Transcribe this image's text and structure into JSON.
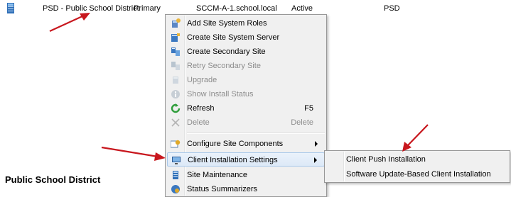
{
  "site_row": {
    "code_name": "PSD - Public School District",
    "type": "Primary",
    "server": "SCCM-A-1.school.local",
    "state": "Active",
    "code": "PSD"
  },
  "details_heading": "Public School District",
  "context_menu": {
    "items": [
      {
        "label": "Add Site System Roles",
        "icon": "add-roles-icon",
        "enabled": true
      },
      {
        "label": "Create Site System Server",
        "icon": "create-server-icon",
        "enabled": true
      },
      {
        "label": "Create Secondary Site",
        "icon": "secondary-site-icon",
        "enabled": true
      },
      {
        "label": "Retry Secondary Site",
        "icon": "retry-icon",
        "enabled": false
      },
      {
        "label": "Upgrade",
        "icon": "upgrade-icon",
        "enabled": false
      },
      {
        "label": "Show Install Status",
        "icon": "info-icon",
        "enabled": false
      },
      {
        "label": "Refresh",
        "icon": "refresh-icon",
        "enabled": true,
        "shortcut": "F5"
      },
      {
        "label": "Delete",
        "icon": "delete-icon",
        "enabled": false,
        "shortcut": "Delete"
      },
      {
        "label": "Configure Site Components",
        "icon": "configure-icon",
        "enabled": true,
        "submenu": true
      },
      {
        "label": "Client Installation Settings",
        "icon": "client-install-icon",
        "enabled": true,
        "submenu": true,
        "highlighted": true
      },
      {
        "label": "Site Maintenance",
        "icon": "maintenance-icon",
        "enabled": true
      },
      {
        "label": "Status Summarizers",
        "icon": "status-summarizer-icon",
        "enabled": true
      }
    ]
  },
  "submenu": {
    "items": [
      {
        "label": "Client Push Installation"
      },
      {
        "label": "Software Update-Based Client Installation"
      }
    ]
  },
  "colors": {
    "annotation_arrow": "#c8171e",
    "menu_bg": "#f0f0f0",
    "highlight_border": "#a8c8ea"
  }
}
